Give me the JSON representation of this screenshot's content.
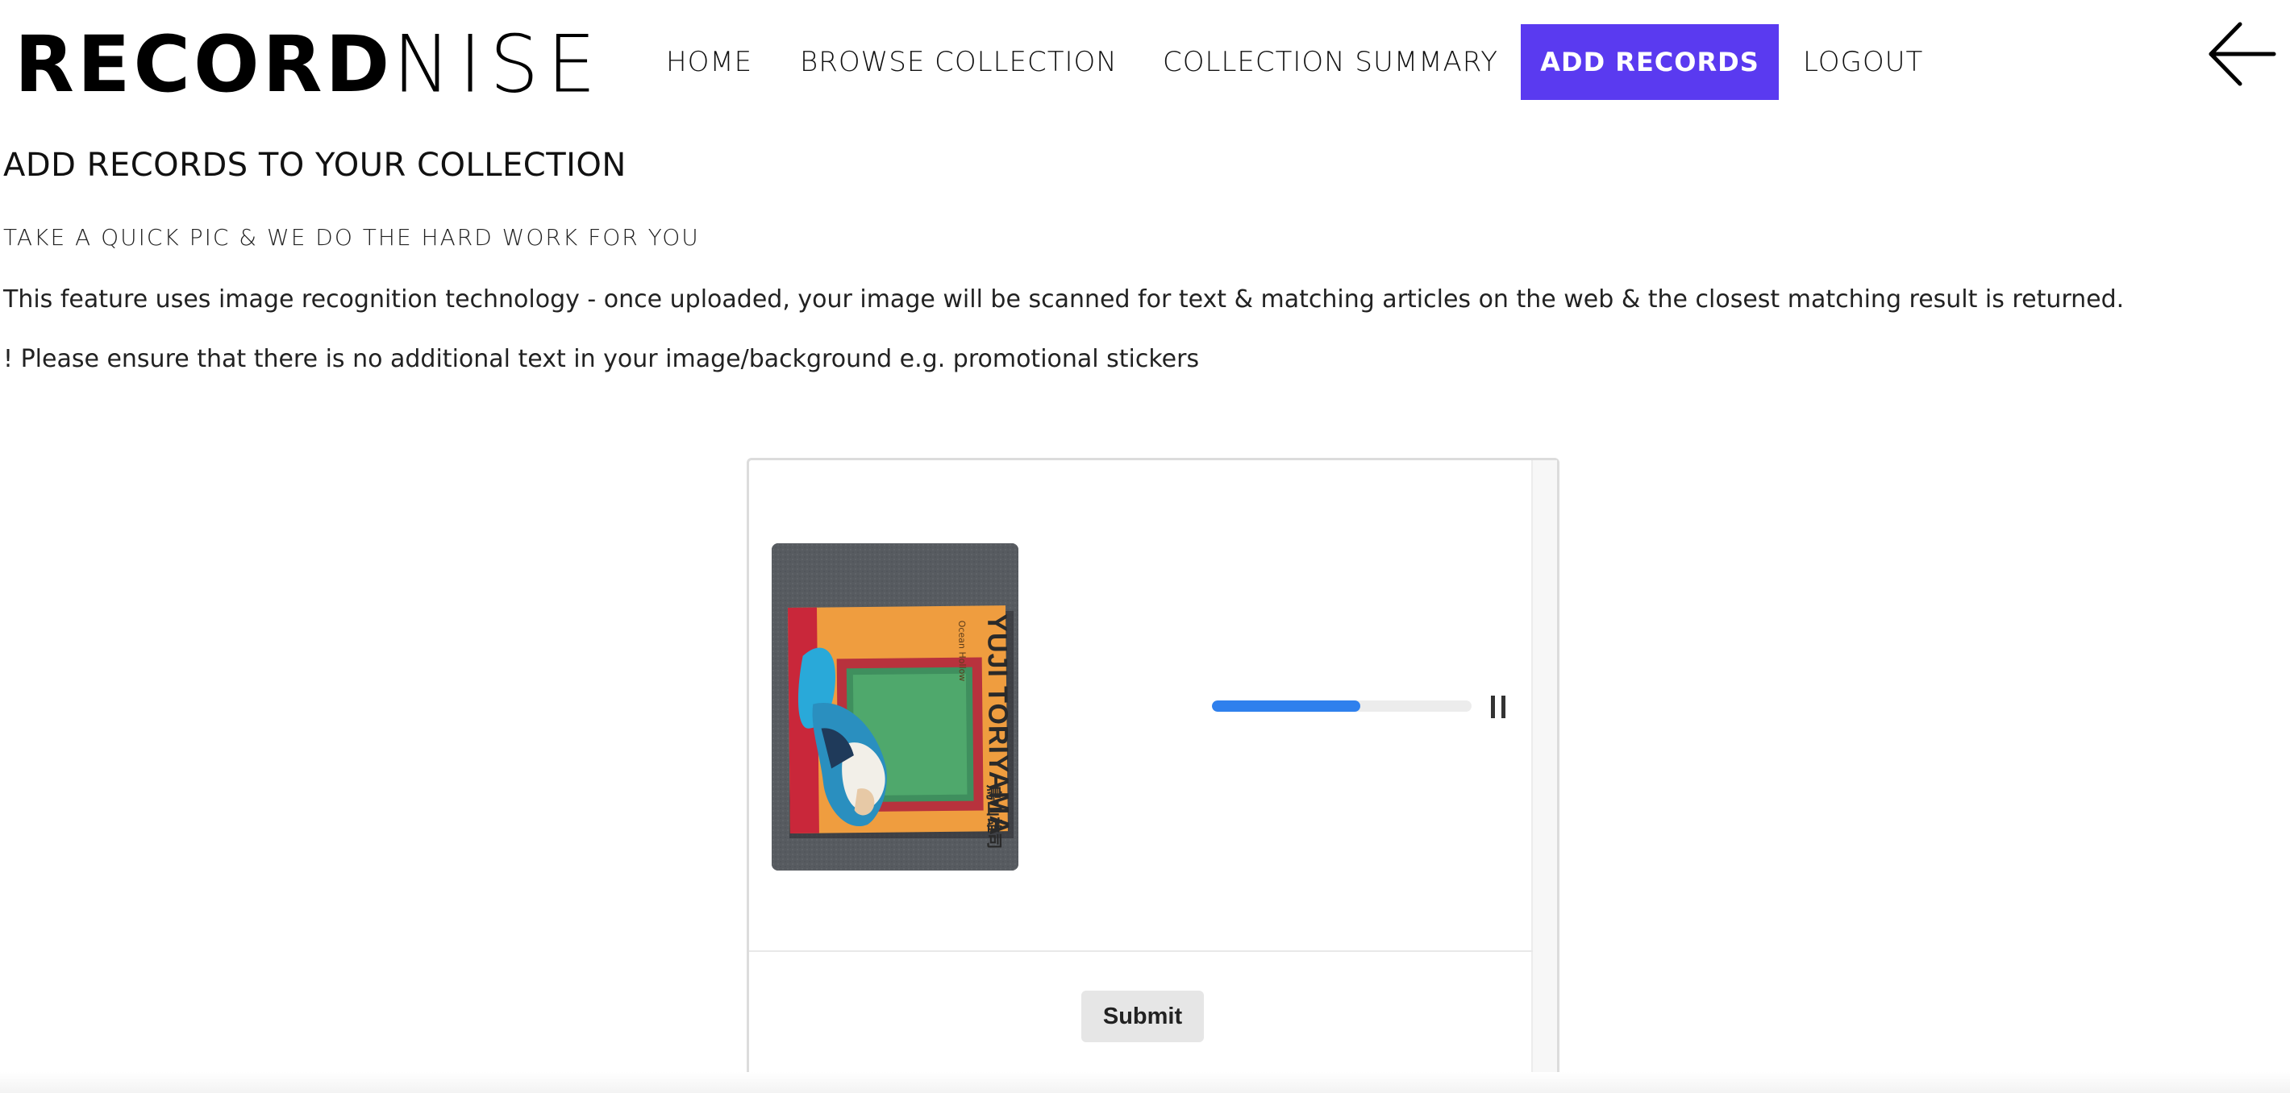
{
  "brand": {
    "logo_bold": "RECORD",
    "logo_light": "NISE"
  },
  "nav": {
    "items": [
      {
        "label": "HOME"
      },
      {
        "label": "BROWSE COLLECTION"
      },
      {
        "label": "COLLECTION SUMMARY"
      },
      {
        "label": "ADD RECORDS",
        "active": true
      },
      {
        "label": "LOGOUT"
      }
    ],
    "back_icon": "arrow-left-icon"
  },
  "page": {
    "title": "ADD RECORDS TO YOUR COLLECTION",
    "subtitle": "TAKE A QUICK PIC & WE DO THE HARD WORK FOR YOU",
    "description": "This feature uses image recognition technology - once uploaded, your image will be scanned for text & matching articles on the web & the closest matching result is returned.",
    "notice": "! Please ensure that there is no additional text in your image/background e.g. promotional stickers"
  },
  "upload": {
    "thumbnail": {
      "artist_text": "YUJI TORIYAMA",
      "japanese_text": "鳥山雄司",
      "small_text": "Ocean Hollow"
    },
    "progress": 0.57,
    "pause_icon": "pause-icon",
    "submit_label": "Submit"
  },
  "colors": {
    "accent": "#5a3af0",
    "progress": "#2f80ed",
    "progress_track": "#ececec"
  }
}
